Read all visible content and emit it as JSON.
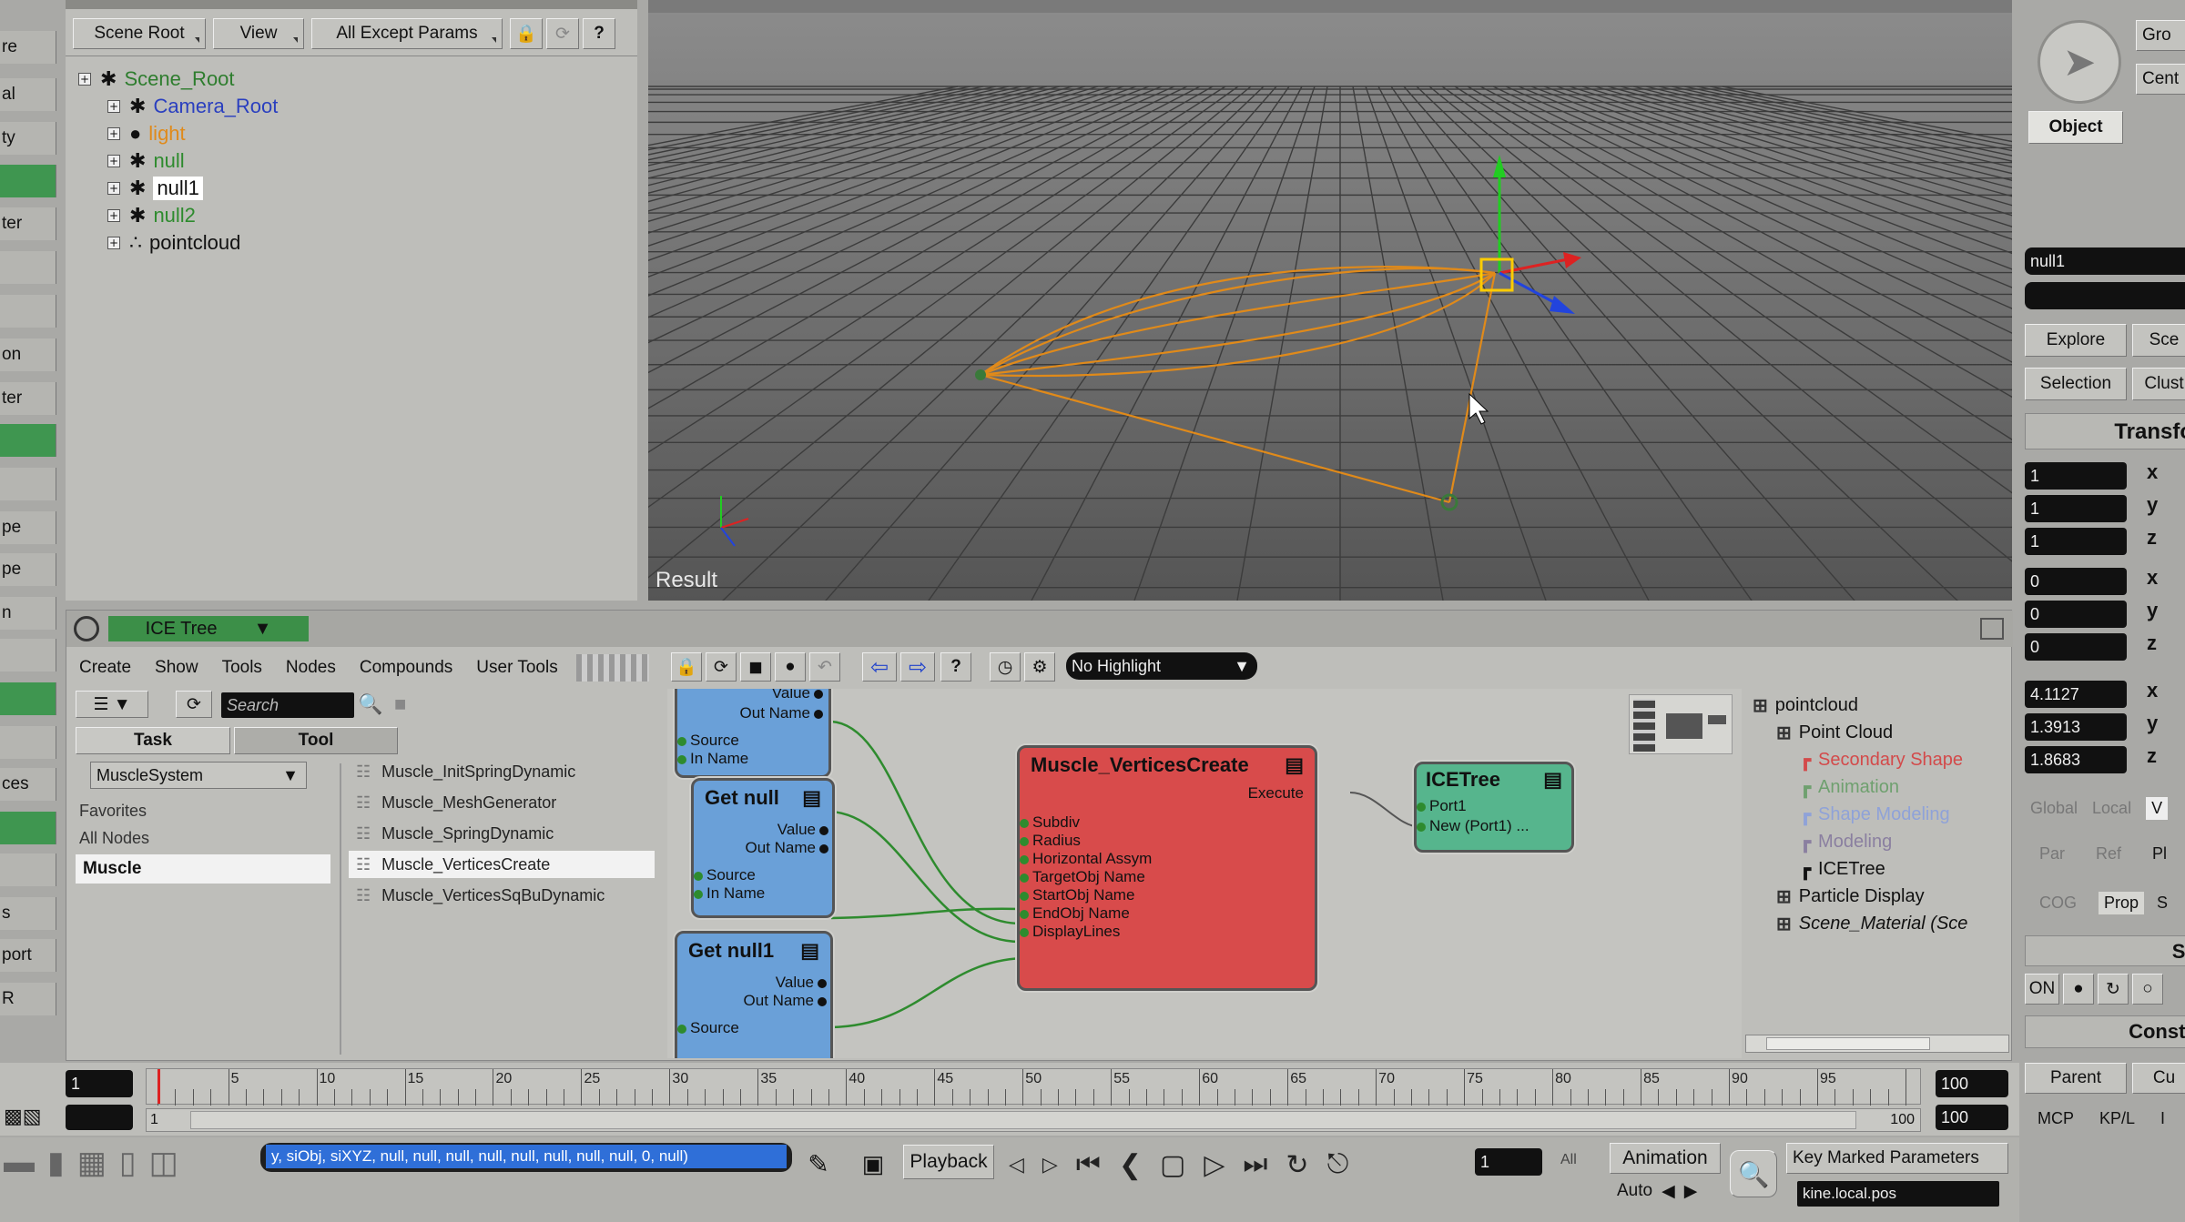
{
  "explorer": {
    "tabs": [
      "Scene Root",
      "View",
      "All Except Params"
    ],
    "tree": [
      {
        "label": "Scene_Root",
        "color": "#2e7d2e",
        "icon": "scene-root-icon"
      },
      {
        "label": "Camera_Root",
        "color": "#2a3fbf",
        "icon": "camera-icon"
      },
      {
        "label": "light",
        "color": "#e08a1a",
        "icon": "light-icon"
      },
      {
        "label": "null",
        "color": "#2e8b2e",
        "icon": "null-icon"
      },
      {
        "label": "null1",
        "color": "#111111",
        "icon": "null-icon"
      },
      {
        "label": "null2",
        "color": "#2e8b2e",
        "icon": "null-icon"
      },
      {
        "label": "pointcloud",
        "color": "#111111",
        "icon": "pointcloud-icon"
      }
    ]
  },
  "left_strip": [
    "re",
    "al",
    "ty",
    "",
    "ter",
    "",
    "",
    "on",
    "ter",
    "",
    "",
    "pe",
    "pe",
    "n",
    "",
    "",
    "",
    "ces",
    "",
    "",
    "s",
    "port",
    "R"
  ],
  "viewport": {
    "label": "Result"
  },
  "ice_tree": {
    "title": "ICE Tree",
    "menu": [
      "Create",
      "Show",
      "Tools",
      "Nodes",
      "Compounds",
      "User Tools"
    ],
    "highlight": "No Highlight",
    "search_placeholder": "Search",
    "tabs": [
      "Task",
      "Tool"
    ],
    "task_select": "MuscleSystem",
    "categories": [
      "Favorites",
      "All Nodes",
      "Muscle"
    ],
    "library": [
      "Muscle_InitSpringDynamic",
      "Muscle_MeshGenerator",
      "Muscle_SpringDynamic",
      "Muscle_VerticesCreate",
      "Muscle_VerticesSqBuDynamic"
    ],
    "nodes": {
      "top": {
        "ports": [
          "Value",
          "Out Name",
          "Source",
          "In Name"
        ]
      },
      "get_null": {
        "title": "Get null",
        "ports": [
          "Value",
          "Out Name",
          "Source",
          "In Name"
        ]
      },
      "get_null1": {
        "title": "Get null1",
        "ports": [
          "Value",
          "Out Name",
          "Source"
        ]
      },
      "muscle": {
        "title": "Muscle_VerticesCreate",
        "output": "Execute",
        "ports": [
          "Subdiv",
          "Radius",
          "Horizontal Assym",
          "TargetObj Name",
          "StartObj Name",
          "EndObj Name",
          "DisplayLines"
        ]
      },
      "icetree": {
        "title": "ICETree",
        "ports": [
          "Port1",
          "New (Port1) ..."
        ]
      }
    },
    "outline": [
      {
        "label": "pointcloud",
        "color": "#111111",
        "indent": 0
      },
      {
        "label": "Point Cloud",
        "color": "#111111",
        "indent": 1
      },
      {
        "label": "Secondary Shape",
        "color": "#d34a4a",
        "indent": 2
      },
      {
        "label": "Animation",
        "color": "#6fa06f",
        "indent": 2
      },
      {
        "label": "Shape Modeling",
        "color": "#8fa2d8",
        "indent": 2
      },
      {
        "label": "Modeling",
        "color": "#8a7fa0",
        "indent": 2
      },
      {
        "label": "ICETree",
        "color": "#111111",
        "indent": 2
      },
      {
        "label": "Particle Display",
        "color": "#111111",
        "indent": 1
      },
      {
        "label": "Scene_Material (Sce",
        "color": "#111111",
        "indent": 1
      }
    ]
  },
  "right_panel": {
    "top_buttons": [
      "Gro",
      "Cent"
    ],
    "object_label": "Object",
    "name_field": "null1",
    "explore_row": [
      "Explore",
      "Sce"
    ],
    "selection_row": [
      "Selection",
      "Clust"
    ],
    "transform_header": "Transfo",
    "scale": [
      {
        "v": "1",
        "axis": "x"
      },
      {
        "v": "1",
        "axis": "y"
      },
      {
        "v": "1",
        "axis": "z"
      }
    ],
    "rotate": [
      {
        "v": "0",
        "axis": "x"
      },
      {
        "v": "0",
        "axis": "y"
      },
      {
        "v": "0",
        "axis": "z"
      }
    ],
    "translate": [
      {
        "v": "4.1127",
        "axis": "x"
      },
      {
        "v": "1.3913",
        "axis": "y"
      },
      {
        "v": "1.8683",
        "axis": "z"
      }
    ],
    "global_local": [
      "Global",
      "Local",
      "V"
    ],
    "par_ref": [
      "Par",
      "Ref",
      "Pl"
    ],
    "cog_prop": [
      "COG",
      "Prop",
      "S"
    ],
    "snap_header": "Sr",
    "on_label": "ON",
    "constr_header": "Constr",
    "parent_row": [
      "Parent",
      "Cu"
    ],
    "mcp_row": [
      "MCP",
      "KP/L",
      "I"
    ]
  },
  "timeline": {
    "start_field": "1",
    "range_start": "1",
    "end_field": "100",
    "range_end_label": "100",
    "range_end_field": "100",
    "labels": [
      "5",
      "10",
      "15",
      "20",
      "25",
      "30",
      "35",
      "40",
      "45",
      "50",
      "55",
      "60",
      "65",
      "70",
      "75",
      "80",
      "85",
      "90",
      "95"
    ],
    "min": 1,
    "max": 100,
    "current": 1
  },
  "bottom": {
    "command": "y, siObj, siXYZ, null, null, null, null, null, null, null, null, 0, null)",
    "playback": "Playback",
    "frame": "1",
    "all": "All",
    "animation": "Animation",
    "auto": "Auto",
    "key_marked": "Key Marked Parameters",
    "kine": "kine.local.pos"
  }
}
